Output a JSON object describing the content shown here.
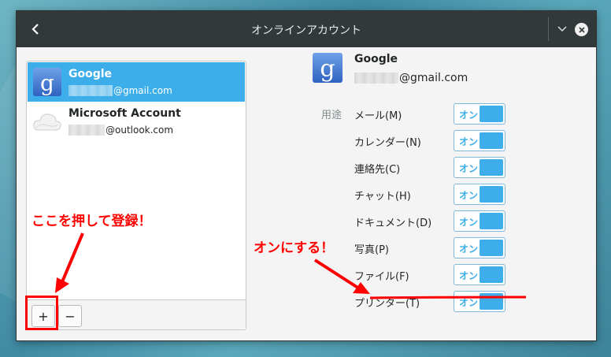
{
  "window": {
    "title": "オンラインアカウント"
  },
  "accounts": [
    {
      "name": "Google",
      "email_suffix": "@gmail.com",
      "icon": "google-icon"
    },
    {
      "name": "Microsoft Account",
      "email_suffix": "@outlook.com",
      "icon": "cloud-icon"
    }
  ],
  "toolbar": {
    "add_label": "+",
    "remove_label": "−"
  },
  "detail": {
    "name": "Google",
    "email_suffix": "@gmail.com",
    "usage_label": "用途",
    "toggle_label": "オン",
    "services": [
      {
        "label": "メール(M)",
        "state": "オン"
      },
      {
        "label": "カレンダー(N)",
        "state": "オン"
      },
      {
        "label": "連絡先(C)",
        "state": "オン"
      },
      {
        "label": "チャット(H)",
        "state": "オン"
      },
      {
        "label": "ドキュメント(D)",
        "state": "オン"
      },
      {
        "label": "写真(P)",
        "state": "オン"
      },
      {
        "label": "ファイル(F)",
        "state": "オン"
      },
      {
        "label": "プリンター(T)",
        "state": "オン"
      }
    ]
  },
  "annotations": {
    "register_hint": "ここを押して登録！",
    "turn_on_hint": "オンにする！",
    "color": "#ff0000"
  },
  "colors": {
    "accent": "#3daee9",
    "titlebar": "#31393b"
  }
}
